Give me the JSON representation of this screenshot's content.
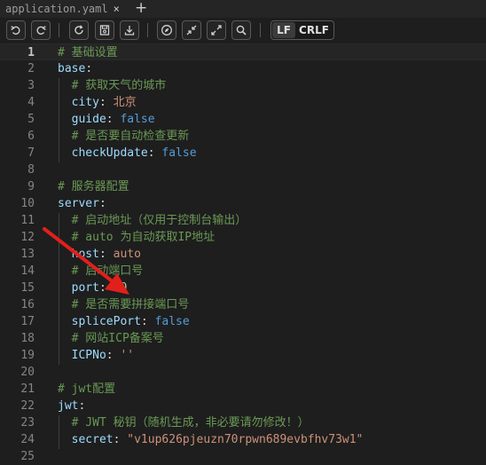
{
  "tab": {
    "filename": "application.yaml",
    "close_glyph": "×",
    "add_glyph": "+"
  },
  "toolbar": {
    "icons": [
      "undo-icon",
      "redo-icon",
      "refresh-icon",
      "save-icon",
      "download-icon",
      "compass-icon",
      "collapse-icon",
      "expand-icon",
      "search-icon"
    ],
    "eol_active": "LF",
    "eol_inactive": "CRLF"
  },
  "editor": {
    "current_line": 1,
    "lines": [
      {
        "n": "1",
        "tokens": [
          {
            "t": "# 基础设置",
            "c": "com"
          }
        ]
      },
      {
        "n": "2",
        "tokens": [
          {
            "t": "base",
            "c": "key"
          },
          {
            "t": ":",
            "c": "punc"
          }
        ]
      },
      {
        "n": "3",
        "tokens": [
          {
            "t": "  # 获取天气的城市",
            "c": "com"
          }
        ]
      },
      {
        "n": "4",
        "tokens": [
          {
            "t": "  city",
            "c": "key"
          },
          {
            "t": ": ",
            "c": "punc"
          },
          {
            "t": "北京",
            "c": "str"
          }
        ]
      },
      {
        "n": "5",
        "tokens": [
          {
            "t": "  guide",
            "c": "key"
          },
          {
            "t": ": ",
            "c": "punc"
          },
          {
            "t": "false",
            "c": "kw"
          }
        ]
      },
      {
        "n": "6",
        "tokens": [
          {
            "t": "  # 是否要自动检查更新",
            "c": "com"
          }
        ]
      },
      {
        "n": "7",
        "tokens": [
          {
            "t": "  checkUpdate",
            "c": "key"
          },
          {
            "t": ": ",
            "c": "punc"
          },
          {
            "t": "false",
            "c": "kw"
          }
        ]
      },
      {
        "n": "8",
        "tokens": []
      },
      {
        "n": "9",
        "tokens": [
          {
            "t": "# 服务器配置",
            "c": "com"
          }
        ]
      },
      {
        "n": "10",
        "tokens": [
          {
            "t": "server",
            "c": "key"
          },
          {
            "t": ":",
            "c": "punc"
          }
        ]
      },
      {
        "n": "11",
        "tokens": [
          {
            "t": "  # 启动地址（仅用于控制台输出）",
            "c": "com"
          }
        ]
      },
      {
        "n": "12",
        "tokens": [
          {
            "t": "  # auto 为自动获取IP地址",
            "c": "com"
          }
        ]
      },
      {
        "n": "13",
        "tokens": [
          {
            "t": "  host",
            "c": "key"
          },
          {
            "t": ": ",
            "c": "punc"
          },
          {
            "t": "auto",
            "c": "str"
          }
        ]
      },
      {
        "n": "14",
        "tokens": [
          {
            "t": "  # 启动端口号",
            "c": "com"
          }
        ]
      },
      {
        "n": "15",
        "tokens": [
          {
            "t": "  port",
            "c": "key"
          },
          {
            "t": ": ",
            "c": "punc"
          },
          {
            "t": "80",
            "c": "num"
          }
        ]
      },
      {
        "n": "16",
        "tokens": [
          {
            "t": "  # 是否需要拼接端口号",
            "c": "com"
          }
        ]
      },
      {
        "n": "17",
        "tokens": [
          {
            "t": "  splicePort",
            "c": "key"
          },
          {
            "t": ": ",
            "c": "punc"
          },
          {
            "t": "false",
            "c": "kw"
          }
        ]
      },
      {
        "n": "18",
        "tokens": [
          {
            "t": "  # 网站ICP备案号",
            "c": "com"
          }
        ]
      },
      {
        "n": "19",
        "tokens": [
          {
            "t": "  ICPNo",
            "c": "key"
          },
          {
            "t": ": ",
            "c": "punc"
          },
          {
            "t": "''",
            "c": "str"
          }
        ]
      },
      {
        "n": "20",
        "tokens": []
      },
      {
        "n": "21",
        "tokens": [
          {
            "t": "# jwt配置",
            "c": "com"
          }
        ]
      },
      {
        "n": "22",
        "tokens": [
          {
            "t": "jwt",
            "c": "key"
          },
          {
            "t": ":",
            "c": "punc"
          }
        ]
      },
      {
        "n": "23",
        "tokens": [
          {
            "t": "  # JWT 秘钥（随机生成，非必要请勿修改！）",
            "c": "com"
          }
        ]
      },
      {
        "n": "24",
        "tokens": [
          {
            "t": "  secret",
            "c": "key"
          },
          {
            "t": ": ",
            "c": "punc"
          },
          {
            "t": "\"v1up626pjeuzn70rpwn689evbfhv73w1\"",
            "c": "str"
          }
        ]
      },
      {
        "n": "25",
        "tokens": []
      }
    ]
  },
  "annotation": {
    "color": "#e0201b"
  }
}
